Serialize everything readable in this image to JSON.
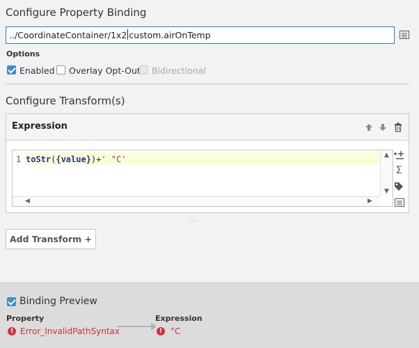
{
  "binding": {
    "title": "Configure Property Binding",
    "path_before_caret": "../CoordinateContainer/1x2",
    "path_after_caret": "custom.airOnTemp",
    "options_label": "Options",
    "options": [
      {
        "label": "Enabled",
        "checked": true,
        "disabled": false
      },
      {
        "label": "Overlay Opt-Out",
        "checked": false,
        "disabled": false
      },
      {
        "label": "Bidirectional",
        "checked": false,
        "disabled": true
      }
    ]
  },
  "transforms": {
    "title": "Configure Transform(s)",
    "panel_title": "Expression",
    "line_number": "1",
    "code": {
      "fn": "toStr",
      "open": "(",
      "arg": "{value}",
      "close": ")+",
      "literal": "' °C'"
    },
    "add_button": "Add Transform +",
    "grip": "···"
  },
  "preview": {
    "title": "Binding Preview",
    "checked": true,
    "property_label": "Property",
    "property_value": "Error_InvalidPathSyntax",
    "expression_label": "Expression",
    "expression_value": "°C",
    "error_glyph": "!"
  },
  "icons": {
    "move_up": "arrow-up-icon",
    "move_down": "arrow-down-icon",
    "delete": "trash-icon",
    "insert_property": "insert-property-icon",
    "functions": "sigma-icon",
    "tags": "tag-icon",
    "browse": "list-icon",
    "error": "error-icon"
  },
  "colors": {
    "accent": "#1f7fd1",
    "checkbox": "#3b8fd4",
    "error": "#c8323a",
    "code_highlight": "#fdfcd9"
  }
}
